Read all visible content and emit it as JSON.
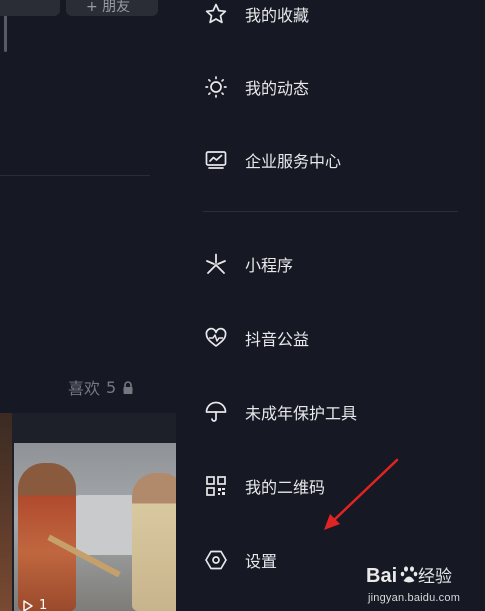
{
  "background_page": {
    "top_button_right_label": "+ 朋友",
    "likes_label": "喜欢",
    "likes_count": "5",
    "play_count": "1"
  },
  "drawer": {
    "items": [
      {
        "label": "我的收藏",
        "icon": "star-icon"
      },
      {
        "label": "我的动态",
        "icon": "sun-icon"
      },
      {
        "label": "企业服务中心",
        "icon": "monitor-chart-icon"
      },
      {
        "label": "小程序",
        "icon": "asterisk-icon"
      },
      {
        "label": "抖音公益",
        "icon": "heart-pulse-icon"
      },
      {
        "label": "未成年保护工具",
        "icon": "umbrella-icon"
      },
      {
        "label": "我的二维码",
        "icon": "qr-code-icon"
      },
      {
        "label": "设置",
        "icon": "hexagon-settings-icon"
      }
    ]
  },
  "watermark": {
    "logo": "Baidu经验",
    "url": "jingyan.baidu.com"
  },
  "colors": {
    "background": "#161823",
    "text": "#e8e8ea",
    "annotation_arrow": "#e02424"
  }
}
